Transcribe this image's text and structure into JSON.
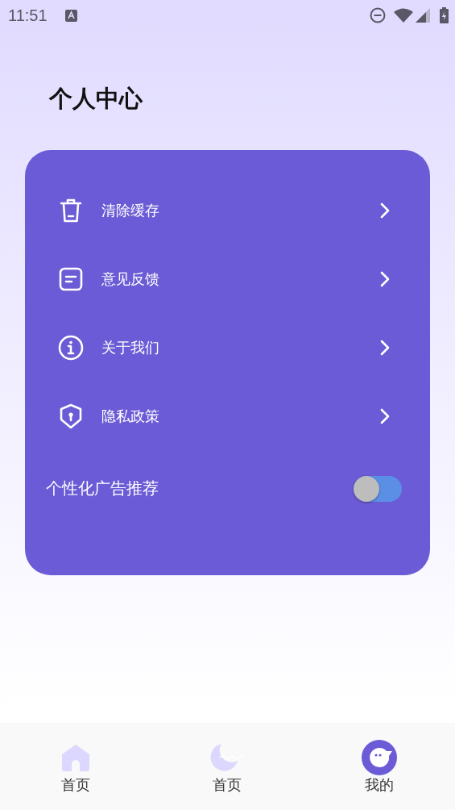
{
  "status_bar": {
    "time": "11:51"
  },
  "title": "个人中心",
  "menu": [
    {
      "kind": "trash",
      "label": "清除缓存"
    },
    {
      "kind": "feedback",
      "label": "意见反馈"
    },
    {
      "kind": "info",
      "label": "关于我们"
    },
    {
      "kind": "shield",
      "label": "隐私政策"
    }
  ],
  "setting": {
    "label": "个性化广告推荐",
    "on": false
  },
  "nav": [
    {
      "kind": "home",
      "label": "首页",
      "selected": false
    },
    {
      "kind": "moon",
      "label": "首页",
      "selected": false
    },
    {
      "kind": "me",
      "label": "我的",
      "selected": true
    }
  ]
}
